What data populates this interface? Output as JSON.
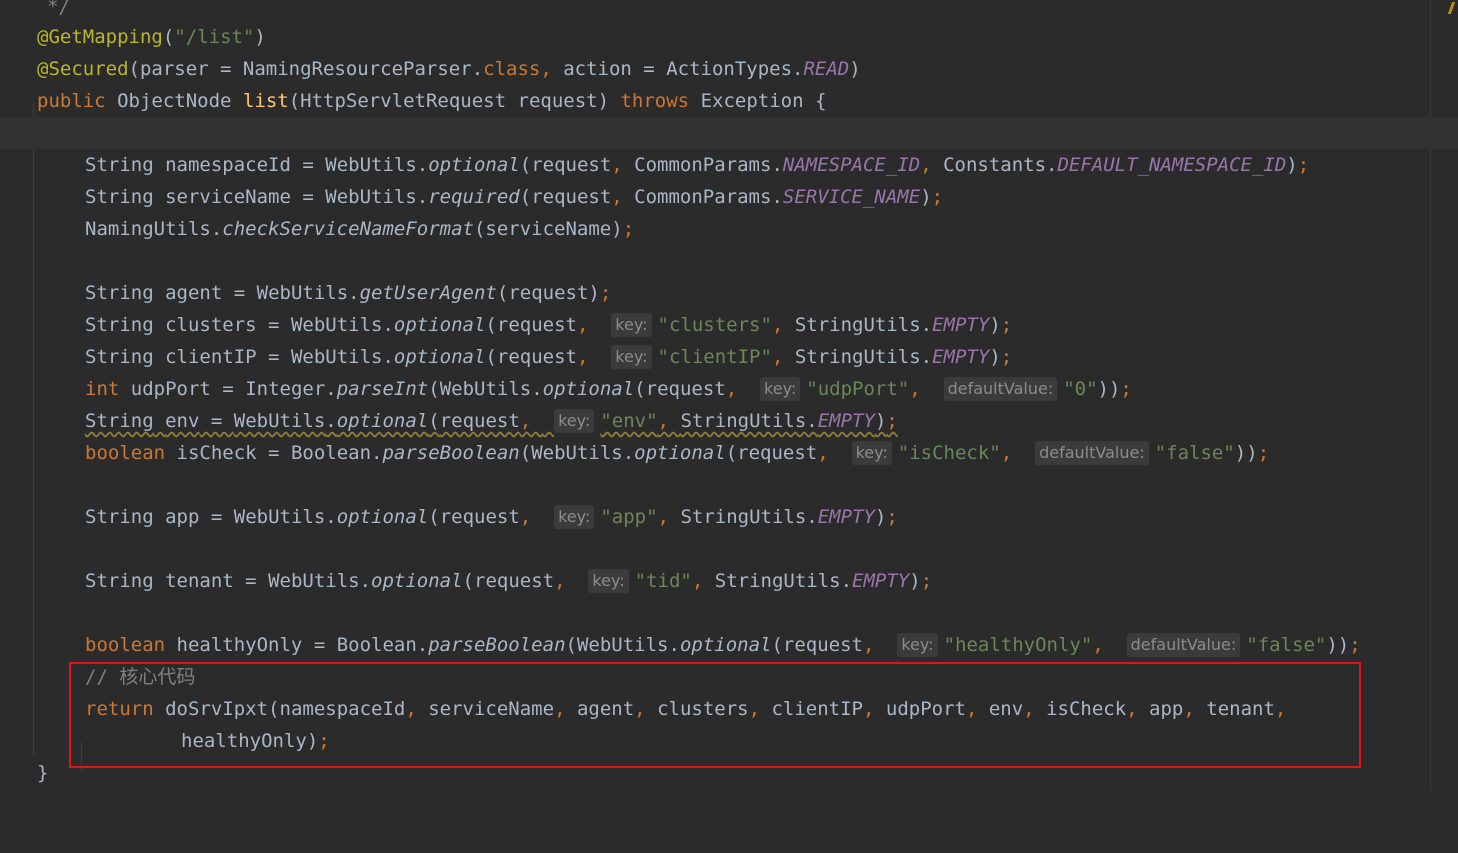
{
  "colors": {
    "background": "#2b2b2b",
    "keyword": "#cc7832",
    "annotation": "#bbb529",
    "string": "#6a8759",
    "number": "#6897bb",
    "comment": "#808080",
    "method_declaration": "#ffc66d",
    "static_constant": "#9876aa",
    "highlight_box": "#e0151c"
  },
  "code": {
    "doc_end": "*/",
    "get_mapping": {
      "annotation": "@GetMapping",
      "path": "\"/list\""
    },
    "secured": {
      "annotation": "@Secured",
      "parser": "NamingResourceParser",
      "class_kw": "class",
      "action": "ActionTypes",
      "read": "READ"
    },
    "signature": {
      "public": "public",
      "return_type": "ObjectNode",
      "method": "list",
      "param_type": "HttpServletRequest",
      "param": "request",
      "throws": "throws",
      "exception": "Exception"
    },
    "namespace_line": {
      "type": "String",
      "var": "namespaceId",
      "cls": "WebUtils",
      "method": "optional",
      "params_cls": "CommonParams",
      "constant": "NAMESPACE_ID",
      "constants_cls": "Constants",
      "default_constant": "DEFAULT_NAMESPACE_ID"
    },
    "service_line": {
      "type": "String",
      "var": "serviceName",
      "cls": "WebUtils",
      "method": "required",
      "params_cls": "CommonParams",
      "constant": "SERVICE_NAME"
    },
    "check_line": {
      "cls": "NamingUtils",
      "method": "checkServiceNameFormat",
      "arg": "serviceName"
    },
    "agent_line": {
      "type": "String",
      "var": "agent",
      "cls": "WebUtils",
      "method": "getUserAgent"
    },
    "clusters_line": {
      "type": "String",
      "var": "clusters",
      "value": "\"clusters\""
    },
    "clientip_line": {
      "type": "String",
      "var": "clientIP",
      "value": "\"clientIP\""
    },
    "udpport_line": {
      "type": "int",
      "var": "udpPort",
      "cls": "Integer",
      "method": "parseInt",
      "value": "\"udpPort\"",
      "default": "\"0\""
    },
    "env_line": {
      "type": "String",
      "var": "env",
      "value": "\"env\""
    },
    "ischeck_line": {
      "type": "boolean",
      "var": "isCheck",
      "cls": "Boolean",
      "method": "parseBoolean",
      "value": "\"isCheck\"",
      "default": "\"false\""
    },
    "app_line": {
      "type": "String",
      "var": "app",
      "value": "\"app\""
    },
    "tenant_line": {
      "type": "String",
      "var": "tenant",
      "value": "\"tid\""
    },
    "healthy_line": {
      "type": "boolean",
      "var": "healthyOnly",
      "cls": "Boolean",
      "method": "parseBoolean",
      "value": "\"healthyOnly\"",
      "default": "\"false\""
    },
    "comment": "// 核心代码",
    "return_line": {
      "kw": "return",
      "call": "doSrvIpxt",
      "args": [
        "namespaceId",
        "serviceName",
        "agent",
        "clusters",
        "clientIP",
        "udpPort",
        "env",
        "isCheck",
        "app",
        "tenant"
      ],
      "last_arg": "healthyOnly"
    },
    "close_brace": "}",
    "common": {
      "request": "request",
      "webutils": "WebUtils",
      "optional": "optional",
      "stringutils": "StringUtils",
      "empty": "EMPTY",
      "open_brace": "{"
    }
  },
  "hints": {
    "key": "key:",
    "default_value": "defaultValue:"
  }
}
